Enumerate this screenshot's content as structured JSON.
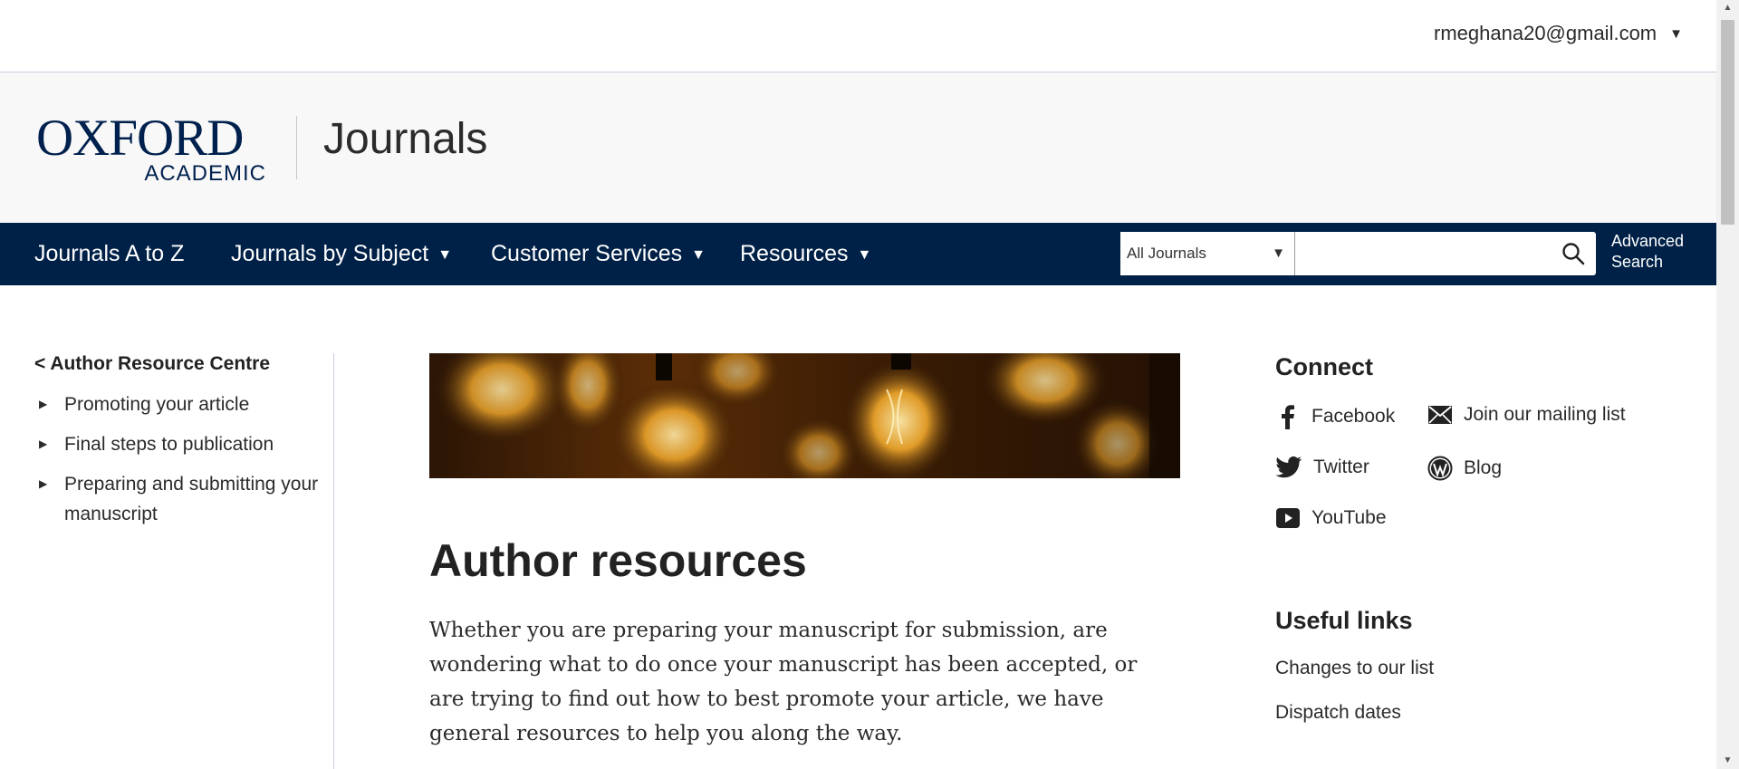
{
  "user": {
    "email": "rmeghana20@gmail.com"
  },
  "brand": {
    "logo_main": "OXFORD",
    "logo_sub": "ACADEMIC",
    "title": "Journals"
  },
  "nav": {
    "items": [
      {
        "label": "Journals A to Z",
        "has_dropdown": false
      },
      {
        "label": "Journals by Subject",
        "has_dropdown": true
      },
      {
        "label": "Customer Services",
        "has_dropdown": true
      },
      {
        "label": "Resources",
        "has_dropdown": true
      }
    ],
    "search_scope": "All Journals",
    "search_value": "",
    "advanced_search_line1": "Advanced",
    "advanced_search_line2": "Search"
  },
  "sidebar": {
    "back_label": "< Author Resource Centre",
    "items": [
      {
        "label": "Promoting your article"
      },
      {
        "label": "Final steps to publication"
      },
      {
        "label": "Preparing and submitting your manuscript"
      }
    ]
  },
  "main": {
    "title": "Author resources",
    "intro": "Whether you are preparing your manuscript for submission, are wondering what to do once your manuscript has been accepted, or are trying to find out how to best promote your article, we have general resources to help you along the way."
  },
  "connect": {
    "title": "Connect",
    "links": [
      {
        "label": "Facebook",
        "icon": "facebook-icon"
      },
      {
        "label": "Join our mailing list",
        "icon": "mail-icon"
      },
      {
        "label": "Twitter",
        "icon": "twitter-icon"
      },
      {
        "label": "Blog",
        "icon": "wordpress-icon"
      },
      {
        "label": "YouTube",
        "icon": "youtube-icon"
      }
    ]
  },
  "useful_links": {
    "title": "Useful links",
    "links": [
      {
        "label": "Changes to our list"
      },
      {
        "label": "Dispatch dates"
      }
    ]
  },
  "colors": {
    "navy": "#002147",
    "brand_bg": "#f8f8f8"
  }
}
